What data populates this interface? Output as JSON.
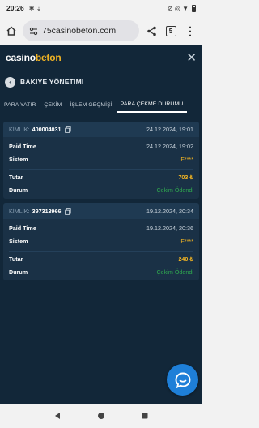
{
  "status": {
    "time": "20:26",
    "left_icons": "✱ ⇣",
    "right_icons": "⊘ ◎ ▼"
  },
  "browser": {
    "url": "75casinobeton.com",
    "tab_count": "5"
  },
  "app": {
    "brand_prefix": "c",
    "brand_rest_1": "asino",
    "brand_rest_2": "beton",
    "section_title": "BAKİYE YÖNETİMİ",
    "tabs": [
      {
        "label": "PARA YATIR"
      },
      {
        "label": "ÇEKİM"
      },
      {
        "label": "İŞLEM GEÇMİŞİ"
      },
      {
        "label": "PARA ÇEKME DURUMU"
      }
    ],
    "labels": {
      "id": "KİMLİK:",
      "paid_time": "Paid Time",
      "system": "Sistem",
      "amount": "Tutar",
      "status": "Durum"
    },
    "records": [
      {
        "id": "400004031",
        "date": "24.12.2024, 19:01",
        "paid_time": "24.12.2024, 19:02",
        "system": "F****",
        "amount": "703 ₺",
        "status": "Çekim Ödendi"
      },
      {
        "id": "397313966",
        "date": "19.12.2024, 20:34",
        "paid_time": "19.12.2024, 20:36",
        "system": "F****",
        "amount": "240 ₺",
        "status": "Çekim Ödendi"
      }
    ]
  },
  "colors": {
    "background": "#122739",
    "card": "#1a3146",
    "accent_gold": "#f0b323",
    "status_green": "#2fa84f",
    "chat_blue": "#1e7fd8"
  }
}
